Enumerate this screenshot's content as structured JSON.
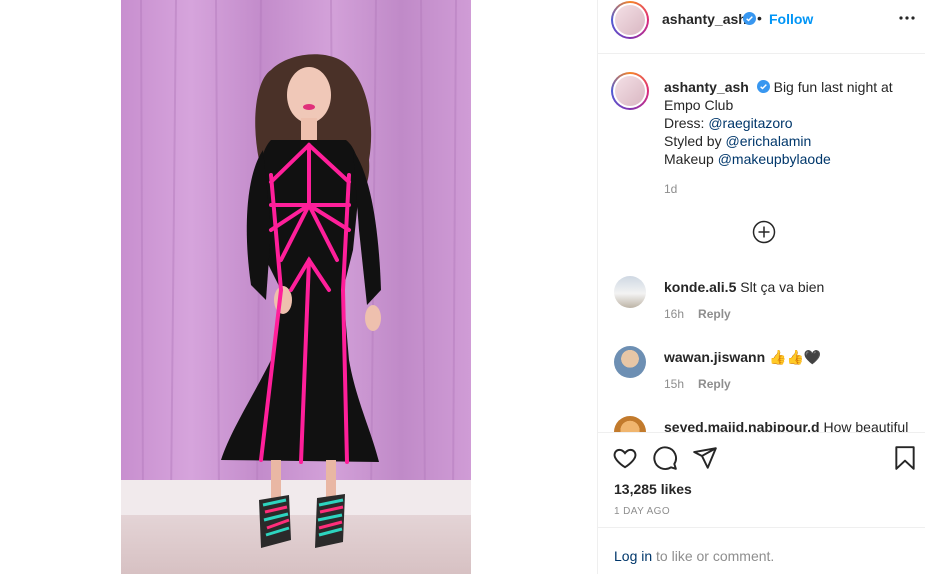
{
  "post": {
    "author": "ashanty_ash",
    "follow_label": "Follow",
    "separator": "•",
    "more_icon": "more-horizontal-icon",
    "verified_icon": "verified-badge-icon",
    "caption": {
      "author": "ashanty_ash",
      "line1": "Big fun last night at",
      "line2": "Empo Club",
      "dress_label": "Dress: ",
      "dress_mention": "@raegitazoro",
      "styled_label": "Styled by ",
      "styled_mention": "@erichalamin",
      "makeup_label": "Makeup ",
      "makeup_mention": "@makeupbylaode",
      "time": "1d"
    },
    "load_more_icon": "plus-circle-icon",
    "comments": [
      {
        "user": "konde.ali.5",
        "text": "Slt ça va bien",
        "time": "16h",
        "reply": "Reply"
      },
      {
        "user": "wawan.jiswann",
        "text": "👍👍🖤",
        "time": "15h",
        "reply": "Reply"
      },
      {
        "user": "seyed.majid.nabipour.d",
        "text": "How beautiful"
      }
    ],
    "likes": "13,285 likes",
    "age": "1 DAY AGO",
    "login": {
      "link": "Log in",
      "rest": " to like or comment."
    }
  }
}
